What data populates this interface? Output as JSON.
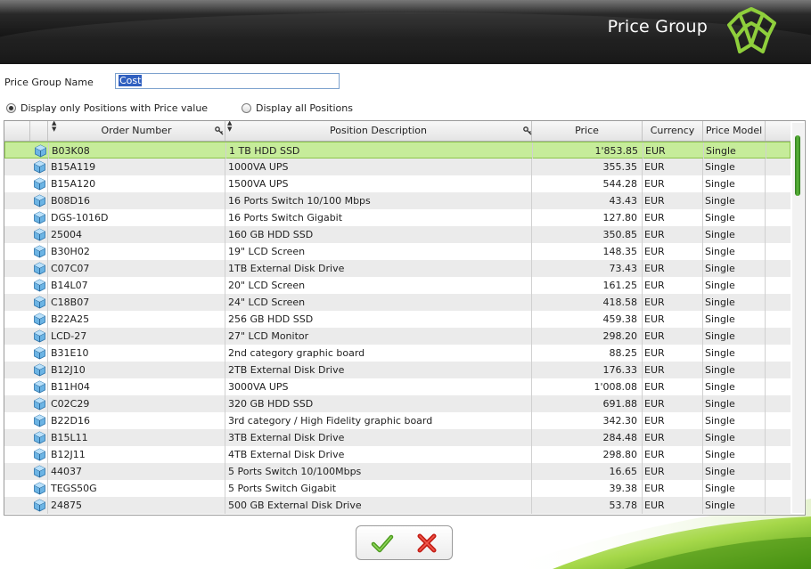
{
  "window": {
    "title": "Price Group"
  },
  "form": {
    "name_label": "Price Group Name",
    "name_value": "Cost"
  },
  "filter": {
    "options": [
      {
        "label": "Display only Positions with Price value",
        "selected": true
      },
      {
        "label": "Display all Positions",
        "selected": false
      }
    ]
  },
  "table": {
    "columns": [
      "Order Number",
      "Position Description",
      "Price",
      "Currency",
      "Price Model"
    ],
    "selected_index": 0,
    "rows": [
      {
        "order": "B03K08",
        "desc": "1 TB HDD SSD",
        "price": "1'853.85",
        "currency": "EUR",
        "model": "Single"
      },
      {
        "order": "B15A119",
        "desc": "1000VA UPS",
        "price": "355.35",
        "currency": "EUR",
        "model": "Single"
      },
      {
        "order": "B15A120",
        "desc": "1500VA UPS",
        "price": "544.28",
        "currency": "EUR",
        "model": "Single"
      },
      {
        "order": "B08D16",
        "desc": "16 Ports Switch 10/100 Mbps",
        "price": "43.43",
        "currency": "EUR",
        "model": "Single"
      },
      {
        "order": "DGS-1016D",
        "desc": "16 Ports Switch Gigabit",
        "price": "127.80",
        "currency": "EUR",
        "model": "Single"
      },
      {
        "order": "25004",
        "desc": "160 GB HDD SSD",
        "price": "350.85",
        "currency": "EUR",
        "model": "Single"
      },
      {
        "order": "B30H02",
        "desc": "19\" LCD Screen",
        "price": "148.35",
        "currency": "EUR",
        "model": "Single"
      },
      {
        "order": "C07C07",
        "desc": "1TB External Disk Drive",
        "price": "73.43",
        "currency": "EUR",
        "model": "Single"
      },
      {
        "order": "B14L07",
        "desc": "20\" LCD Screen",
        "price": "161.25",
        "currency": "EUR",
        "model": "Single"
      },
      {
        "order": "C18B07",
        "desc": "24\" LCD Screen",
        "price": "418.58",
        "currency": "EUR",
        "model": "Single"
      },
      {
        "order": "B22A25",
        "desc": "256 GB HDD SSD",
        "price": "459.38",
        "currency": "EUR",
        "model": "Single"
      },
      {
        "order": "LCD-27",
        "desc": "27\" LCD Monitor",
        "price": "298.20",
        "currency": "EUR",
        "model": "Single"
      },
      {
        "order": "B31E10",
        "desc": "2nd category graphic board",
        "price": "88.25",
        "currency": "EUR",
        "model": "Single"
      },
      {
        "order": "B12J10",
        "desc": "2TB External Disk Drive",
        "price": "176.33",
        "currency": "EUR",
        "model": "Single"
      },
      {
        "order": "B11H04",
        "desc": "3000VA UPS",
        "price": "1'008.08",
        "currency": "EUR",
        "model": "Single"
      },
      {
        "order": "C02C29",
        "desc": "320 GB HDD SSD",
        "price": "691.88",
        "currency": "EUR",
        "model": "Single"
      },
      {
        "order": "B22D16",
        "desc": "3rd category / High Fidelity graphic board",
        "price": "342.30",
        "currency": "EUR",
        "model": "Single"
      },
      {
        "order": "B15L11",
        "desc": "3TB External Disk Drive",
        "price": "284.48",
        "currency": "EUR",
        "model": "Single"
      },
      {
        "order": "B12J11",
        "desc": "4TB External Disk Drive",
        "price": "298.80",
        "currency": "EUR",
        "model": "Single"
      },
      {
        "order": "44037",
        "desc": "5 Ports Switch 10/100Mbps",
        "price": "16.65",
        "currency": "EUR",
        "model": "Single"
      },
      {
        "order": "TEGS50G",
        "desc": "5 Ports Switch Gigabit",
        "price": "39.38",
        "currency": "EUR",
        "model": "Single"
      },
      {
        "order": "24875",
        "desc": "500 GB External Disk Drive",
        "price": "53.78",
        "currency": "EUR",
        "model": "Single"
      }
    ]
  },
  "buttons": {
    "ok_icon": "checkmark-icon",
    "cancel_icon": "red-x-icon"
  },
  "colors": {
    "accent_green": "#5cb83a",
    "selection": "#c6ec9a",
    "header_dark": "#141414"
  }
}
